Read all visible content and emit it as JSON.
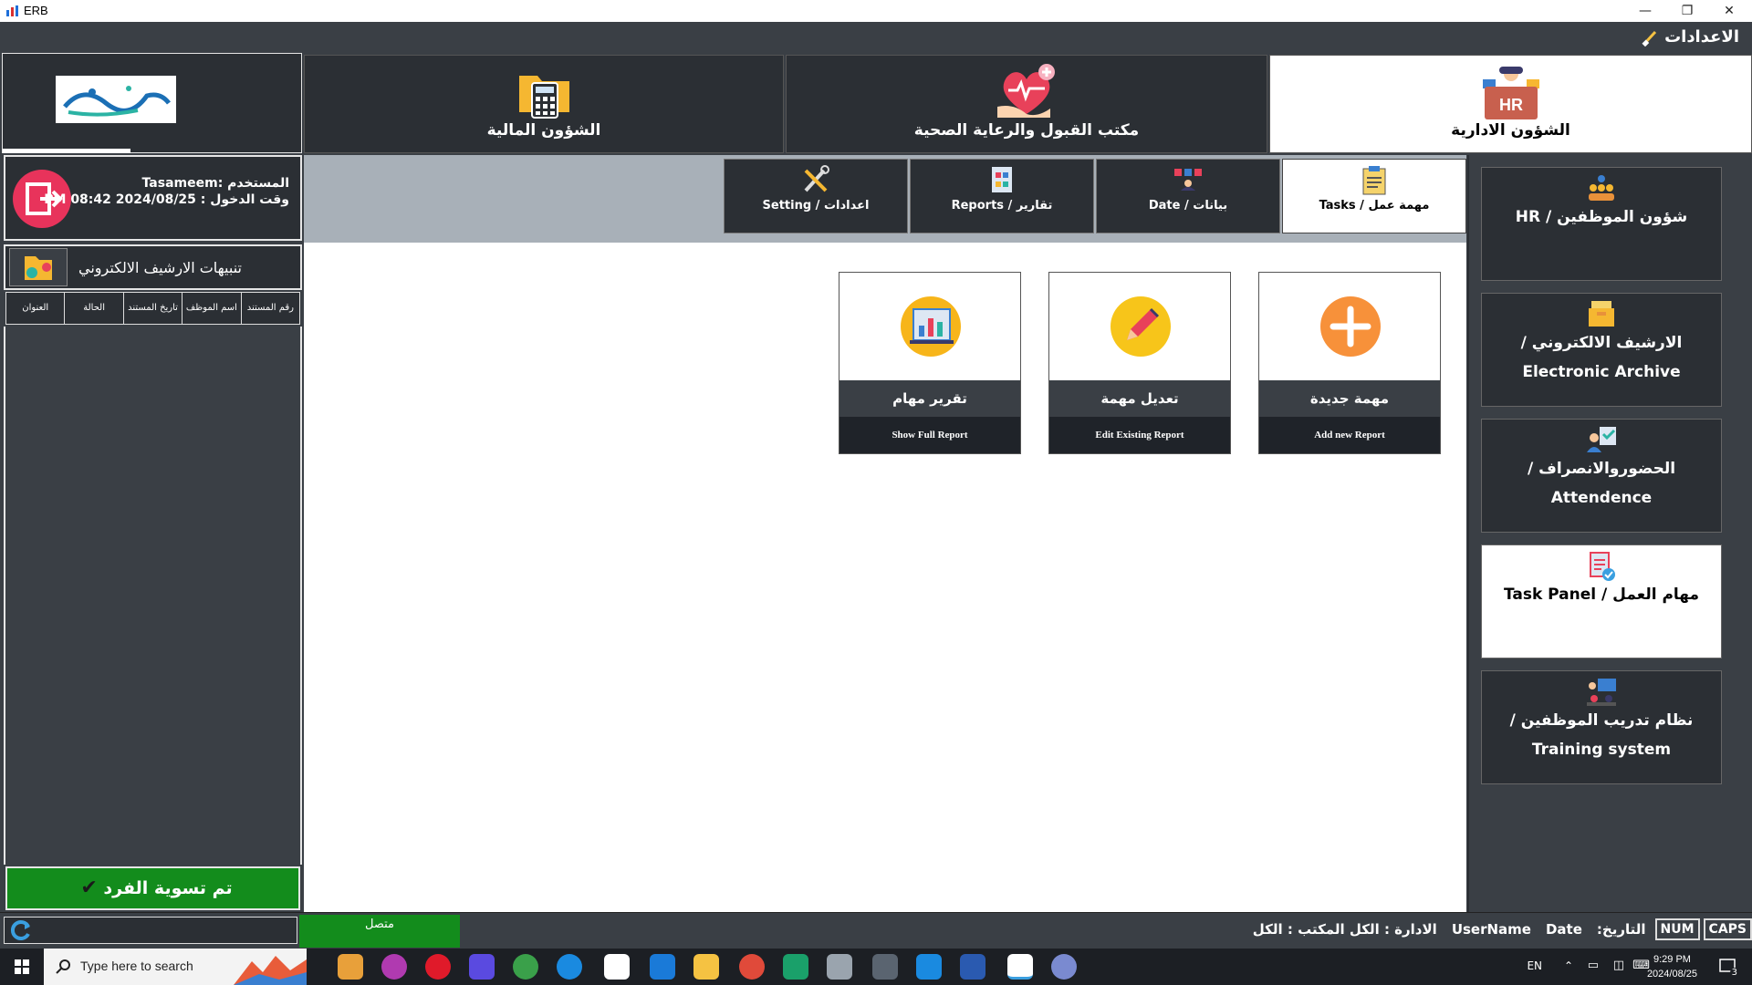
{
  "window": {
    "title": "ERB",
    "minimize": "—",
    "maximize": "❐",
    "close": "✕"
  },
  "settings": {
    "label": "الاعدادات"
  },
  "main_tabs": [
    {
      "label": "الشؤون الادارية",
      "icon": "hr-icon",
      "active": true
    },
    {
      "label": "مكتب القبول والرعاية الصحية",
      "icon": "health-care-icon",
      "active": false
    },
    {
      "label": "الشؤون المالية",
      "icon": "finance-calculator-icon",
      "active": false
    }
  ],
  "user": {
    "user_line": "المستخدم :Tasameem",
    "login_line": "وقت الدخول : PM 08:42 2024/08/25"
  },
  "alerts": {
    "title": "تنبيهات الارشيف الالكتروني",
    "columns": [
      "العنوان",
      "الحالة",
      "تاريخ المستند",
      "اسم الموظف",
      "رقم المستند"
    ]
  },
  "settle_button": {
    "label": "تم تسوية الفرد",
    "check": "✔"
  },
  "sub_tabs": [
    {
      "label": "مهمة عمل / Tasks",
      "active": true
    },
    {
      "label": "بيانات / Date",
      "active": false
    },
    {
      "label": "تقارير / Reports",
      "active": false
    },
    {
      "label": "اعدادات / Setting",
      "active": false
    }
  ],
  "cards": [
    {
      "title": "مهمة جديدة",
      "subtitle": "Add new Report",
      "color": "#f7913a",
      "glyph": "+"
    },
    {
      "title": "تعديل مهمة",
      "subtitle": "Edit Existing Report",
      "color": "#f7c51a",
      "glyph": "✎"
    },
    {
      "title": "تقرير مهام",
      "subtitle": "Show Full Report",
      "color": "#f7b51a",
      "glyph": "▥"
    }
  ],
  "sidebar": [
    {
      "label": "شؤون الموظفين / HR",
      "active": false
    },
    {
      "label": "الارشيف الالكتروني / Electronic Archive",
      "active": false
    },
    {
      "label": "الحضوروالانصراف / Attendence",
      "active": false
    },
    {
      "label": "مهام العمل / Task Panel",
      "active": true
    },
    {
      "label": "نظام تدريب الموظفين / Training system",
      "active": false
    }
  ],
  "status": {
    "connected": "متصل",
    "caps": "CAPS",
    "num": "NUM",
    "date_label": "التاريخ:",
    "date_field": "Date",
    "username_field": "UserName",
    "department": "الادارة : الكل المكتب : الكل"
  },
  "taskbar": {
    "search_placeholder": "Type here to search",
    "language": "EN",
    "time": "9:29 PM",
    "date": "2024/08/25",
    "notifications": "3"
  }
}
